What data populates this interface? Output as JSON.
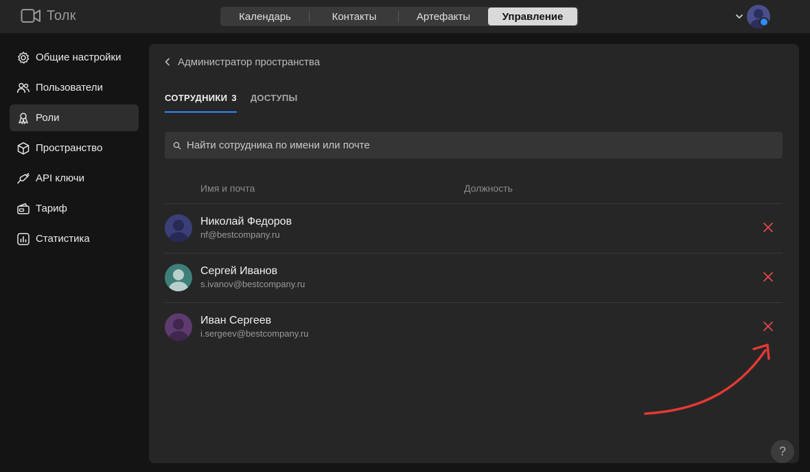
{
  "app": {
    "name": "Толк"
  },
  "topnav": {
    "tabs": [
      {
        "label": "Календарь",
        "active": false
      },
      {
        "label": "Контакты",
        "active": false
      },
      {
        "label": "Артефакты",
        "active": false
      },
      {
        "label": "Управление",
        "active": true
      }
    ]
  },
  "sidebar": {
    "items": [
      {
        "label": "Общие настройки",
        "icon": "gear-icon",
        "active": false
      },
      {
        "label": "Пользователи",
        "icon": "users-icon",
        "active": false
      },
      {
        "label": "Роли",
        "icon": "roles-icon",
        "active": true
      },
      {
        "label": "Пространство",
        "icon": "cube-icon",
        "active": false
      },
      {
        "label": "API ключи",
        "icon": "api-key-icon",
        "active": false
      },
      {
        "label": "Тариф",
        "icon": "wallet-icon",
        "active": false
      },
      {
        "label": "Статистика",
        "icon": "chart-icon",
        "active": false
      }
    ]
  },
  "main": {
    "back_label": "Администратор пространства",
    "tabs": [
      {
        "label": "СОТРУДНИКИ",
        "count": "3",
        "active": true
      },
      {
        "label": "ДОСТУПЫ",
        "active": false
      }
    ],
    "search": {
      "placeholder": "Найти сотрудника по имени или почте"
    },
    "table": {
      "columns": [
        "Имя и почта",
        "Должность"
      ],
      "rows": [
        {
          "name": "Николай Федоров",
          "email": "nf@bestcompany.ru",
          "avatar_color": "#3b3f78"
        },
        {
          "name": "Сергей Иванов",
          "email": "s.ivanov@bestcompany.ru",
          "avatar_color": "#3f7f7a"
        },
        {
          "name": "Иван Сергеев",
          "email": "i.sergeev@bestcompany.ru",
          "avatar_color": "#5e3b6e"
        }
      ]
    }
  },
  "colors": {
    "accent": "#2f8cff",
    "delete": "#e5484d",
    "annotation_arrow": "#e53935"
  },
  "help": {
    "label": "?"
  }
}
